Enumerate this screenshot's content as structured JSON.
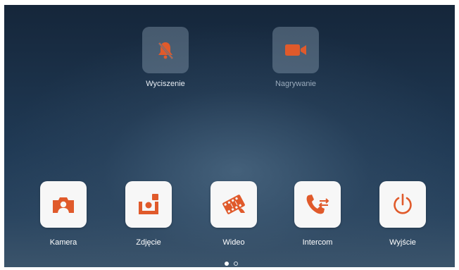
{
  "colors": {
    "accent": "#e05a2b",
    "tile_light": "#f7f7f7",
    "tile_translucent": "rgba(150,170,190,0.38)"
  },
  "top_actions": [
    {
      "label": "Wyciszenie",
      "icon": "bell-muted-icon",
      "state": "active"
    },
    {
      "label": "Nagrywanie",
      "icon": "video-camera-icon",
      "state": "dimmed"
    }
  ],
  "apps": [
    {
      "label": "Kamera",
      "icon": "camera-icon"
    },
    {
      "label": "Zdjęcie",
      "icon": "photo-icon"
    },
    {
      "label": "Wideo",
      "icon": "film-icon"
    },
    {
      "label": "Intercom",
      "icon": "phone-transfer-icon"
    },
    {
      "label": "Wyjście",
      "icon": "power-icon"
    }
  ],
  "pagination": {
    "current_page": 1,
    "total_pages": 2
  }
}
